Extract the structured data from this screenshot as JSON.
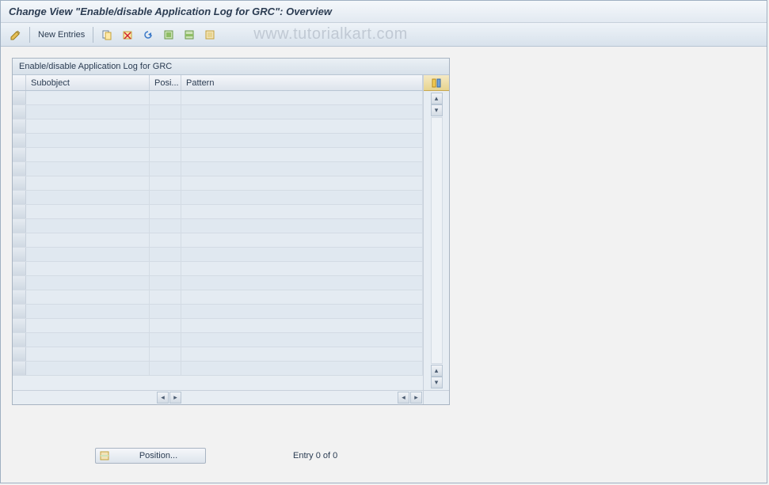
{
  "title": "Change View \"Enable/disable Application Log for GRC\": Overview",
  "toolbar": {
    "new_entries": "New Entries"
  },
  "watermark": "www.tutorialkart.com",
  "panel": {
    "title": "Enable/disable Application Log for GRC",
    "columns": {
      "subobject": "Subobject",
      "position": "Posi...",
      "pattern": "Pattern"
    },
    "row_count": 20,
    "rows": []
  },
  "footer": {
    "position_button": "Position...",
    "entry_status": "Entry 0 of 0"
  }
}
